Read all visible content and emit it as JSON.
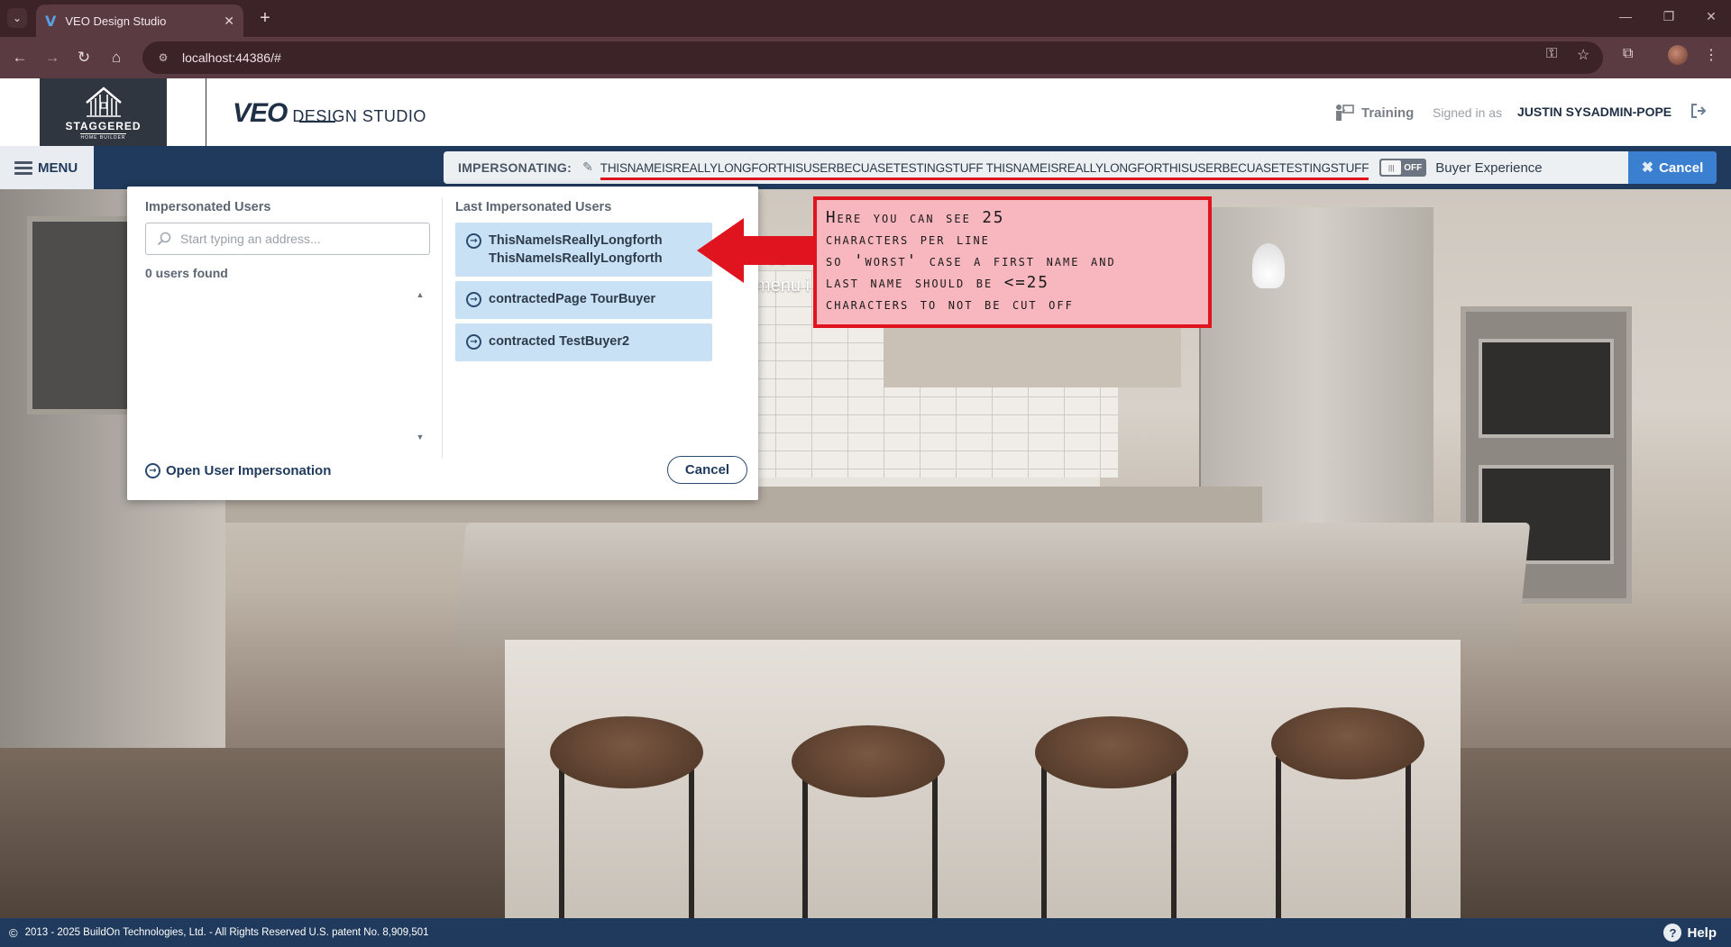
{
  "browser": {
    "tab_title": "VEO Design Studio",
    "tab_favicon": "V",
    "tab_close": "✕",
    "new_tab": "+",
    "url": "localhost:44386/#",
    "window_controls": [
      "—",
      "❐",
      "✕"
    ]
  },
  "header": {
    "logo_name": "STAGGERED",
    "logo_sub": "HOME BUILDER",
    "app_mark": "VEO",
    "app_text": "DESIGN STUDIO",
    "training_label": "Training",
    "signed_in_label": "Signed in as",
    "username": "JUSTIN SYSADMIN-POPE"
  },
  "navbar": {
    "menu_label": "MENU",
    "impersonating_label": "IMPERSONATING:",
    "impersonated_name": "THISNAMEISREALLYLONGFORTHISUSERBECUASETESTINGSTUFF THISNAMEISREALLYLONGFORTHISUSERBECUASETESTINGSTUFF",
    "toggle_state": "OFF",
    "buyer_experience_label": "Buyer Experience",
    "cancel_label": "Cancel"
  },
  "hero": {
    "peek_big": "n",
    "peek_text": "menu i"
  },
  "panel": {
    "left_title": "Impersonated Users",
    "search_placeholder": "Start typing an address...",
    "users_found": "0 users found",
    "open_impersonation_label": "Open User Impersonation",
    "right_title": "Last Impersonated Users",
    "last_users": [
      {
        "line1": "ThisNameIsReallyLongforth",
        "line2": "ThisNameIsReallyLongforth"
      },
      {
        "line1": "contractedPage TourBuyer",
        "line2": ""
      },
      {
        "line1": "contracted TestBuyer2",
        "line2": ""
      }
    ],
    "cancel_label": "Cancel"
  },
  "annotation": {
    "lines": [
      "Here you can see 25",
      "characters per line",
      "so 'worst' case a first name and",
      "last name should be <=25",
      "characters to not be cut off"
    ]
  },
  "footer": {
    "copyright": "2013 - 2025 BuildOn Technologies, Ltd. - All Rights Reserved U.S. patent No. 8,909,501",
    "help_label": "Help"
  },
  "colors": {
    "brand_navy": "#1f3a5c",
    "accent_blue": "#3a7fd0",
    "annotation_red": "#e0141e",
    "annotation_fill": "#f8b7be",
    "list_item_bg": "#c9e1f5"
  }
}
